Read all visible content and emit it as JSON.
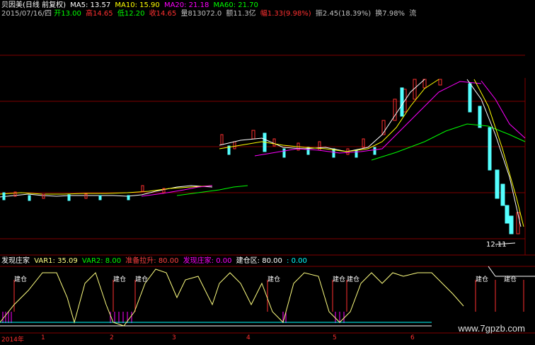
{
  "header": {
    "stock_label": "贝因美(日线 前复权)",
    "ma5": "MA5: 13.57",
    "ma10": "MA10: 15.90",
    "ma20": "MA20: 21.18",
    "ma60": "MA60: 21.70",
    "colors": {
      "ma5": "#ffffff",
      "ma10": "#ffff00",
      "ma20": "#ff00ff",
      "ma60": "#00ff00"
    }
  },
  "quote": {
    "date": "2015/07/16/四",
    "open": "开13.00",
    "high": "高14.65",
    "low": "低12.20",
    "close": "收14.65",
    "volume": "量813072.0",
    "amount": "额11.3亿",
    "change": "幅1.33(9.98%)",
    "amplitude": "振2.45(18.39%)",
    "turnover": "换7.98%",
    "flow": "流"
  },
  "price_panel": {
    "low_label": "12.11"
  },
  "indicator": {
    "name": "发现庄家",
    "var1": "VAR1: 35.09",
    "var2": "VAR2: 8.00",
    "zhunbei": "准备拉升: 80.00",
    "faxian": "发现庄家: 0.00",
    "jiancang": "建仓区: 80.00",
    "last": ": 0.00",
    "jiancang_tag": "建仓",
    "colors": {
      "var1": "#ffff80",
      "var2": "#00ff00",
      "zhunbei": "#ff4040",
      "faxian": "#ff00ff",
      "jiancang": "#ffffff",
      "last": "#00ffff"
    }
  },
  "timeline": {
    "year": "2014年",
    "months": [
      "1",
      "2",
      "3",
      "4",
      "5",
      "6"
    ]
  },
  "watermark": "www.7gpzb.com"
}
